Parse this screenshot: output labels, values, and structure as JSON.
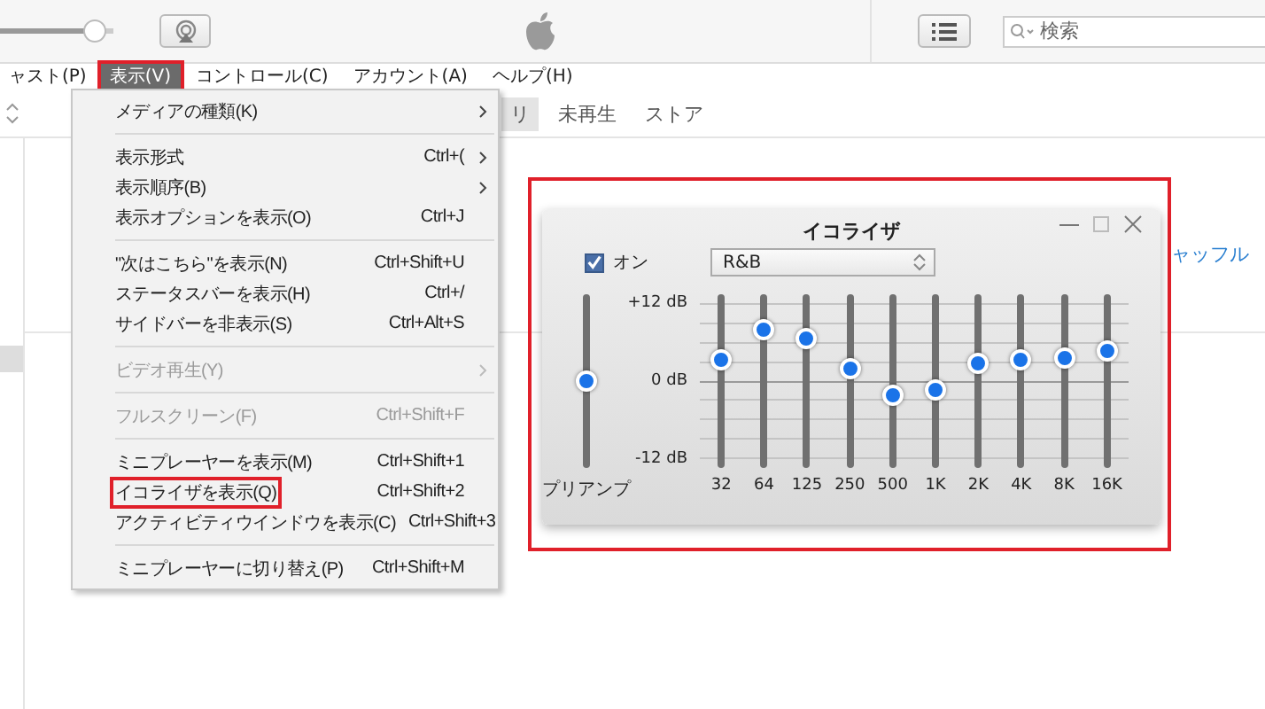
{
  "toolbar": {
    "volume": {
      "level": 0.92
    },
    "search": {
      "placeholder": "検索"
    }
  },
  "menu_bar": [
    {
      "label": "ャスト(P)",
      "selected": false,
      "highlighted": false
    },
    {
      "label": "表示(V)",
      "selected": true,
      "highlighted": true
    },
    {
      "label": "コントロール(C)",
      "selected": false,
      "highlighted": false
    },
    {
      "label": "アカウント(A)",
      "selected": false,
      "highlighted": false
    },
    {
      "label": "ヘルプ(H)",
      "selected": false,
      "highlighted": false
    }
  ],
  "tabs": [
    {
      "label": "リ",
      "selected": true
    },
    {
      "label": "未再生",
      "selected": false
    },
    {
      "label": "ストア",
      "selected": false
    }
  ],
  "background_link": "ャッフル",
  "menu": [
    {
      "kind": "item",
      "label": "メディアの種類(K)",
      "submenu": true,
      "disabled": false,
      "highlighted": false
    },
    {
      "kind": "separator"
    },
    {
      "kind": "item",
      "label": "表示形式",
      "shortcut": "Ctrl+(",
      "submenu": true,
      "disabled": false,
      "highlighted": false
    },
    {
      "kind": "item",
      "label": "表示順序(B)",
      "submenu": true,
      "disabled": false,
      "highlighted": false
    },
    {
      "kind": "item",
      "label": "表示オプションを表示(O)",
      "shortcut": "Ctrl+J",
      "submenu": false,
      "disabled": false,
      "highlighted": false
    },
    {
      "kind": "separator"
    },
    {
      "kind": "item",
      "label": "\"次はこちら\"を表示(N)",
      "shortcut": "Ctrl+Shift+U",
      "submenu": false,
      "disabled": false,
      "highlighted": false
    },
    {
      "kind": "item",
      "label": "ステータスバーを表示(H)",
      "shortcut": "Ctrl+/",
      "submenu": false,
      "disabled": false,
      "highlighted": false
    },
    {
      "kind": "item",
      "label": "サイドバーを非表示(S)",
      "shortcut": "Ctrl+Alt+S",
      "submenu": false,
      "disabled": false,
      "highlighted": false
    },
    {
      "kind": "separator"
    },
    {
      "kind": "item",
      "label": "ビデオ再生(Y)",
      "submenu": true,
      "disabled": true,
      "highlighted": false
    },
    {
      "kind": "separator"
    },
    {
      "kind": "item",
      "label": "フルスクリーン(F)",
      "shortcut": "Ctrl+Shift+F",
      "submenu": false,
      "disabled": true,
      "highlighted": false
    },
    {
      "kind": "separator"
    },
    {
      "kind": "item",
      "label": "ミニプレーヤーを表示(M)",
      "shortcut": "Ctrl+Shift+1",
      "submenu": false,
      "disabled": false,
      "highlighted": false
    },
    {
      "kind": "item",
      "label": "イコライザを表示(Q)",
      "shortcut": "Ctrl+Shift+2",
      "submenu": false,
      "disabled": false,
      "highlighted": true
    },
    {
      "kind": "item",
      "label": "アクティビティウインドウを表示(C)",
      "shortcut": "Ctrl+Shift+3",
      "submenu": false,
      "disabled": false,
      "highlighted": false
    },
    {
      "kind": "separator"
    },
    {
      "kind": "item",
      "label": "ミニプレーヤーに切り替え(P)",
      "shortcut": "Ctrl+Shift+M",
      "submenu": false,
      "disabled": false,
      "highlighted": false
    }
  ],
  "equalizer": {
    "highlighted": true,
    "title": "イコライザ",
    "enabled": {
      "label": "オン",
      "checked": true
    },
    "preset": "R&B",
    "scale": [
      "+12 dB",
      "0 dB",
      "-12 dB"
    ],
    "preamp": {
      "label": "プリアンプ",
      "level": 0.5
    },
    "bands": [
      {
        "label": "32",
        "level": 0.62
      },
      {
        "label": "64",
        "level": 0.8
      },
      {
        "label": "125",
        "level": 0.75
      },
      {
        "label": "250",
        "level": 0.57
      },
      {
        "label": "500",
        "level": 0.42
      },
      {
        "label": "1K",
        "level": 0.45
      },
      {
        "label": "2K",
        "level": 0.6
      },
      {
        "label": "4K",
        "level": 0.62
      },
      {
        "label": "8K",
        "level": 0.63
      },
      {
        "label": "16K",
        "level": 0.67
      }
    ]
  }
}
